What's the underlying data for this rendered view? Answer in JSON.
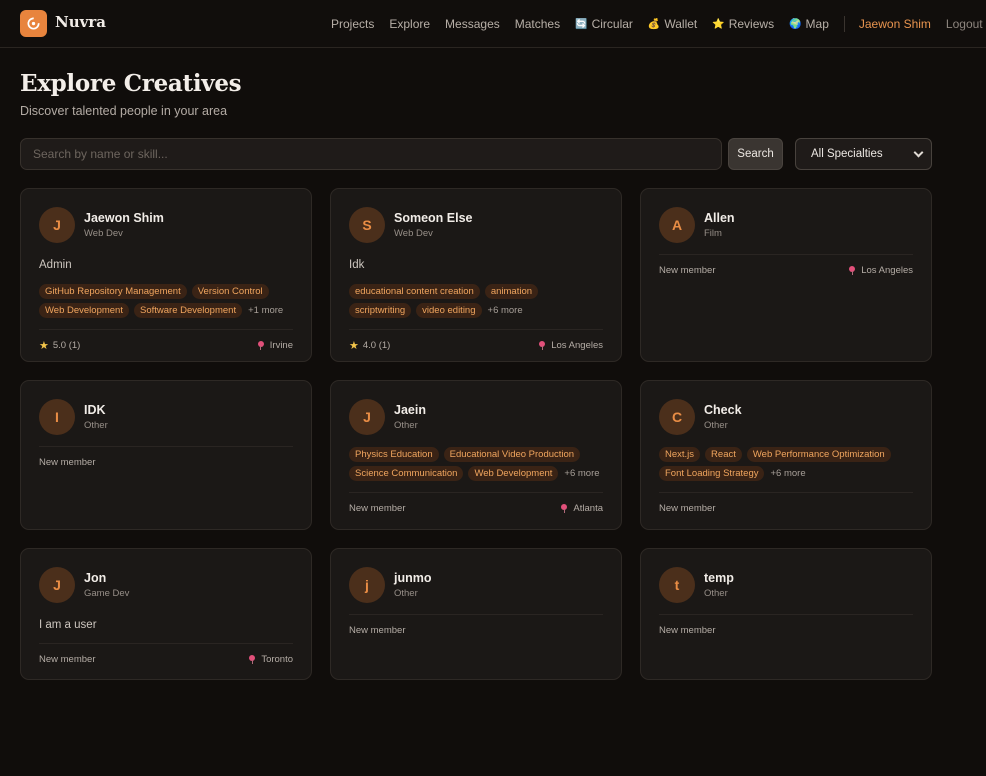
{
  "header": {
    "brand": "Nuvra",
    "nav": [
      {
        "label": "Projects",
        "icon": ""
      },
      {
        "label": "Explore",
        "icon": ""
      },
      {
        "label": "Messages",
        "icon": ""
      },
      {
        "label": "Matches",
        "icon": ""
      },
      {
        "label": "Circular",
        "icon": "🔄"
      },
      {
        "label": "Wallet",
        "icon": "💰"
      },
      {
        "label": "Reviews",
        "icon": "⭐"
      },
      {
        "label": "Map",
        "icon": "🌍"
      }
    ],
    "user": "Jaewon Shim",
    "logout": "Logout"
  },
  "page": {
    "title": "Explore Creatives",
    "subtitle": "Discover talented people in your area"
  },
  "search": {
    "placeholder": "Search by name or skill...",
    "button": "Search",
    "specialty": "All Specialties"
  },
  "colors": {
    "accent": "#e8843d",
    "tag_bg": "#3a2315",
    "tag_text": "#f0a55e"
  },
  "cards": [
    {
      "initial": "J",
      "name": "Jaewon Shim",
      "role": "Web Dev",
      "bio": "Admin",
      "tags": [
        "GitHub Repository Management",
        "Version Control",
        "Web Development",
        "Software Development"
      ],
      "more": "+1 more",
      "rating": "5.0 (1)",
      "status": "",
      "location": "Irvine"
    },
    {
      "initial": "S",
      "name": "Someon Else",
      "role": "Web Dev",
      "bio": "Idk",
      "tags": [
        "educational content creation",
        "animation",
        "scriptwriting",
        "video editing"
      ],
      "more": "+6 more",
      "rating": "4.0 (1)",
      "status": "",
      "location": "Los Angeles"
    },
    {
      "initial": "A",
      "name": "Allen",
      "role": "Film",
      "bio": "",
      "tags": [],
      "more": "",
      "rating": "",
      "status": "New member",
      "location": "Los Angeles"
    },
    {
      "initial": "I",
      "name": "IDK",
      "role": "Other",
      "bio": "",
      "tags": [],
      "more": "",
      "rating": "",
      "status": "New member",
      "location": ""
    },
    {
      "initial": "J",
      "name": "Jaein",
      "role": "Other",
      "bio": "",
      "tags": [
        "Physics Education",
        "Educational Video Production",
        "Science Communication",
        "Web Development"
      ],
      "more": "+6 more",
      "rating": "",
      "status": "New member",
      "location": "Atlanta"
    },
    {
      "initial": "C",
      "name": "Check",
      "role": "Other",
      "bio": "",
      "tags": [
        "Next.js",
        "React",
        "Web Performance Optimization",
        "Font Loading Strategy"
      ],
      "more": "+6 more",
      "rating": "",
      "status": "New member",
      "location": ""
    },
    {
      "initial": "J",
      "name": "Jon",
      "role": "Game Dev",
      "bio": "I am a user",
      "tags": [],
      "more": "",
      "rating": "",
      "status": "New member",
      "location": "Toronto"
    },
    {
      "initial": "j",
      "name": "junmo",
      "role": "Other",
      "bio": "",
      "tags": [],
      "more": "",
      "rating": "",
      "status": "New member",
      "location": ""
    },
    {
      "initial": "t",
      "name": "temp",
      "role": "Other",
      "bio": "",
      "tags": [],
      "more": "",
      "rating": "",
      "status": "New member",
      "location": ""
    }
  ]
}
